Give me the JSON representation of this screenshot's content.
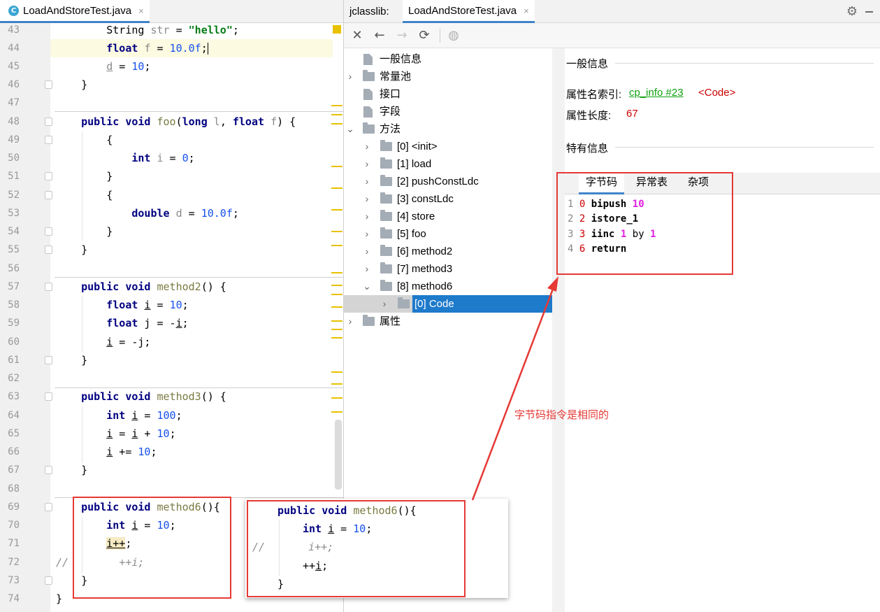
{
  "editor": {
    "tab": {
      "icon": "C",
      "label": "LoadAndStoreTest.java",
      "close": "×"
    }
  },
  "jclasslib": {
    "title": "jclasslib:",
    "tab": {
      "label": "LoadAndStoreTest.java",
      "close": "×"
    },
    "toolbar": [
      "close-icon",
      "back-arrow-icon",
      "forward-arrow-icon",
      "refresh-icon",
      "globe-icon"
    ],
    "tree": {
      "general": "一般信息",
      "constant_pool": "常量池",
      "interfaces": "接口",
      "fields": "字段",
      "methods": "方法",
      "method_items": [
        "[0] <init>",
        "[1] load",
        "[2] pushConstLdc",
        "[3] constLdc",
        "[4] store",
        "[5] foo",
        "[6] method2",
        "[7] method3",
        "[8] method6"
      ],
      "code_item": "[0] Code",
      "attributes": "属性"
    },
    "details": {
      "general_title": "一般信息",
      "name_index_label": "属性名索引:",
      "name_index_link": "cp_info #23",
      "name_index_value": "<Code>",
      "length_label": "属性长度:",
      "length_value": "67",
      "specific_title": "特有信息",
      "tabs": [
        "字节码",
        "异常表",
        "杂项"
      ],
      "bytecode": [
        {
          "line": "1",
          "offset": "0",
          "op": "bipush",
          "args": "10"
        },
        {
          "line": "2",
          "offset": "2",
          "op": "istore_1",
          "args": ""
        },
        {
          "line": "3",
          "offset": "3",
          "op": "iinc",
          "args": "1 by 1"
        },
        {
          "line": "4",
          "offset": "6",
          "op": "return",
          "args": ""
        }
      ]
    }
  },
  "annotation": "字节码指令是相同的",
  "colors": {
    "highlight_box": "#e53935",
    "selection": "#1e7acb",
    "keyword": "#000080",
    "number": "#1750eb",
    "string": "#067d17"
  }
}
